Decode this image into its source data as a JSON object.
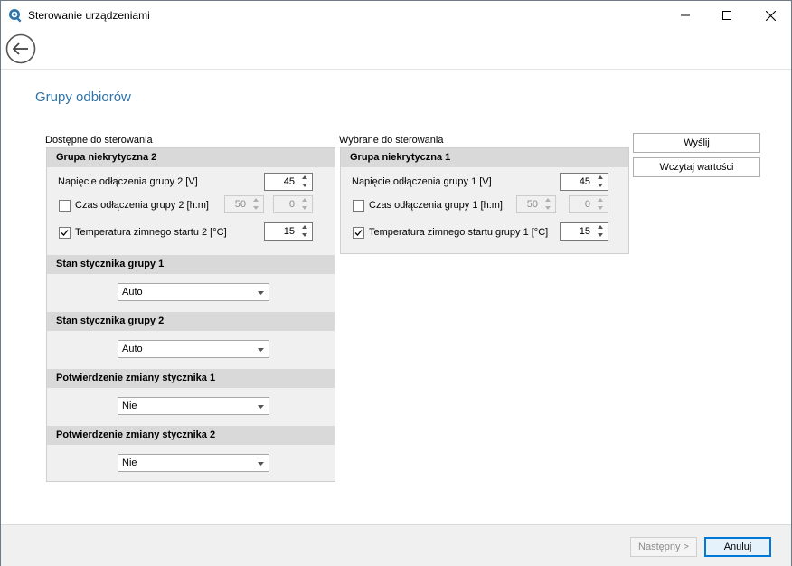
{
  "window": {
    "title": "Sterowanie urządzeniami"
  },
  "page": {
    "title": "Grupy odbiorów"
  },
  "available": {
    "caption": "Dostępne do sterowania",
    "group": {
      "header": "Grupa niekrytyczna 2",
      "voltage_label": "Napięcie odłączenia grupy 2 [V]",
      "voltage_value": "45",
      "time_label": "Czas odłączenia grupy 2 [h:m]",
      "time_checked": false,
      "time_h": "50",
      "time_m": "0",
      "temp_label": "Temperatura zimnego startu 2 [°C]",
      "temp_checked": true,
      "temp_value": "15"
    },
    "contactor1": {
      "header": "Stan stycznika grupy 1",
      "value": "Auto"
    },
    "contactor2": {
      "header": "Stan stycznika grupy 2",
      "value": "Auto"
    },
    "confirm1": {
      "header": "Potwierdzenie zmiany stycznika 1",
      "value": "Nie"
    },
    "confirm2": {
      "header": "Potwierdzenie zmiany stycznika 2",
      "value": "Nie"
    }
  },
  "selected": {
    "caption": "Wybrane do sterowania",
    "group": {
      "header": "Grupa niekrytyczna 1",
      "voltage_label": "Napięcie odłączenia grupy 1 [V]",
      "voltage_value": "45",
      "time_label": "Czas odłączenia grupy 1 [h:m]",
      "time_checked": false,
      "time_h": "50",
      "time_m": "0",
      "temp_label": "Temperatura zimnego startu grupy 1 [°C]",
      "temp_checked": true,
      "temp_value": "15"
    }
  },
  "actions": {
    "send": "Wyślij",
    "load": "Wczytaj wartości"
  },
  "footer": {
    "next": "Następny >",
    "cancel": "Anuluj"
  },
  "colors": {
    "accent": "#2f73a8",
    "header_bg": "#d9d9d9",
    "panel_bg": "#f0f0f0",
    "primary_border": "#0078d7"
  }
}
